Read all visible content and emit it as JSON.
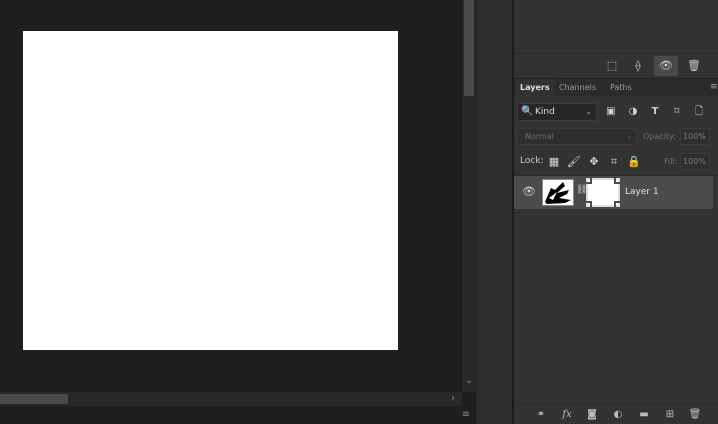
{
  "canvas": {
    "document_color": "#ffffff",
    "scroll_down_glyph": "⌄",
    "scroll_right_glyph": "›",
    "status_menu_glyph": "≡"
  },
  "upper_panel": {
    "toolbar_icons": [
      {
        "name": "marquee-select-icon",
        "glyph": "⬚"
      },
      {
        "name": "transform-icon",
        "glyph": "⟠"
      },
      {
        "name": "eye-icon",
        "glyph": "👁"
      },
      {
        "name": "trash-icon",
        "glyph": "🗑"
      }
    ]
  },
  "layers_panel": {
    "tabs": [
      {
        "label": "Layers",
        "active": true
      },
      {
        "label": "Channels",
        "active": false
      },
      {
        "label": "Paths",
        "active": false
      }
    ],
    "menu_glyph": "≡",
    "filter": {
      "search_glyph": "🔍",
      "kind_label": "Kind",
      "chevron": "⌄",
      "icons": [
        {
          "name": "pixel-filter-icon",
          "glyph": "▣"
        },
        {
          "name": "adjustment-filter-icon",
          "glyph": "◑"
        },
        {
          "name": "type-filter-icon",
          "glyph": "T"
        },
        {
          "name": "shape-filter-icon",
          "glyph": "⌑"
        },
        {
          "name": "smart-object-filter-icon",
          "glyph": "🗋"
        }
      ]
    },
    "blend_mode": "Normal",
    "opacity_label": "Opacity:",
    "opacity_value": "100%",
    "lock_label": "Lock:",
    "lock_icons": [
      {
        "name": "lock-transparent-pixels-icon",
        "glyph": "▦"
      },
      {
        "name": "lock-image-pixels-icon",
        "glyph": "🖌"
      },
      {
        "name": "lock-position-icon",
        "glyph": "✥"
      },
      {
        "name": "lock-artboard-icon",
        "glyph": "⌗"
      },
      {
        "name": "lock-all-icon",
        "glyph": "🔒"
      }
    ],
    "fill_label": "Fill:",
    "fill_value": "100%",
    "layers": [
      {
        "name": "Layer 1",
        "visible": true,
        "has_mask": true,
        "eye_glyph": "👁",
        "link_glyph": "⛓"
      }
    ],
    "footer_icons": [
      {
        "name": "link-layers-icon",
        "glyph": "⚭"
      },
      {
        "name": "fx-icon",
        "glyph": "fx"
      },
      {
        "name": "add-mask-icon",
        "glyph": "◙"
      },
      {
        "name": "adjustment-layer-icon",
        "glyph": "◐"
      },
      {
        "name": "new-group-icon",
        "glyph": "▬"
      },
      {
        "name": "new-layer-icon",
        "glyph": "⊞"
      },
      {
        "name": "delete-layer-icon",
        "glyph": "🗑"
      }
    ]
  }
}
